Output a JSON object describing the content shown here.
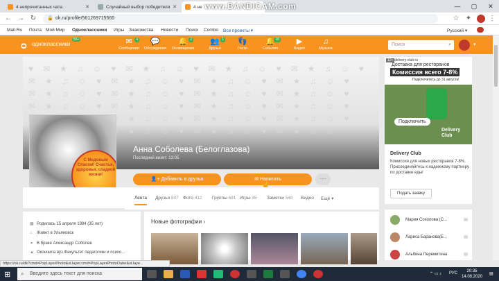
{
  "browser": {
    "tabs": [
      {
        "label": "4 непрочитанных чата"
      },
      {
        "label": "Случайный выбор победителя"
      },
      {
        "label": "4 не"
      }
    ],
    "watermark": "www.BANDICAM.com",
    "url": "ok.ru/profile/561269715565",
    "bookmarks": [
      "Mail.Ru",
      "Почта",
      "Мой Мир",
      "Одноклассники",
      "Игры",
      "Знакомства",
      "Новости",
      "Поиск",
      "Combo",
      "Все проекты ▾"
    ],
    "lang": "Русский ▾"
  },
  "ok": {
    "logo_text": "одноклассники",
    "badge": "55+",
    "nav": [
      {
        "label": "Сообщения",
        "count": "4",
        "icon": "envelope-icon",
        "glyph": "✉"
      },
      {
        "label": "Обсуждения",
        "count": "",
        "icon": "chat-icon",
        "glyph": "💬"
      },
      {
        "label": "Оповещения",
        "count": "2",
        "icon": "bell-icon",
        "glyph": "🔔"
      },
      {
        "label": "Друзья",
        "count": "1",
        "icon": "friends-icon",
        "glyph": "👥"
      },
      {
        "label": "Гости",
        "count": "",
        "icon": "guests-icon",
        "glyph": "👣"
      },
      {
        "label": "События",
        "count": "16",
        "icon": "events-icon",
        "glyph": "🔔"
      },
      {
        "label": "Видео",
        "count": "",
        "icon": "video-icon",
        "glyph": "▶"
      },
      {
        "label": "Музыка",
        "count": "",
        "icon": "music-icon",
        "glyph": "♫"
      }
    ],
    "search_placeholder": "Поиск"
  },
  "profile": {
    "name": "Анна Соболева (Белоглазова)",
    "last_visit": "Последний визит: 13:05",
    "sticker_text": "С Медовым Спасом! Счастья, здоровья, сладкой жизни!",
    "likes": "30",
    "add_friend": "Добавить в друзья",
    "write": "Написать",
    "more": "···",
    "tabs": [
      {
        "label": "Лента",
        "count": ""
      },
      {
        "label": "Друзья",
        "count": "847"
      },
      {
        "label": "Фото",
        "count": "412"
      },
      {
        "label": "Группы",
        "count": "691"
      },
      {
        "label": "Игры",
        "count": "35"
      },
      {
        "label": "Заметки",
        "count": "548"
      },
      {
        "label": "Видео",
        "count": ""
      },
      {
        "label": "Ещё ▾",
        "count": ""
      }
    ],
    "info": [
      "Родилась 15 апреля 1984 (35 лет)",
      "Живет в Ульяновск",
      "В браке Александр Соболев",
      "Окончила вуз Факультет педагогики и психо..."
    ],
    "photos_title": "Новые фотографии ›"
  },
  "ad": {
    "site": "delivery-club.ru",
    "tag": "12+",
    "line1": "Доставка для ресторанов",
    "line2": "Комиссия всего 7-8%",
    "line3": "Подключитесь до 31 августа!",
    "cta": "Подключить",
    "brand_img": "Delivery Club",
    "title": "Delivery Club",
    "text": "Комиссия для новых ресторанов 7-8%. Присоединяйтесь к надежному партнеру по доставке еды!",
    "button": "Подать заявку"
  },
  "friends": [
    {
      "name": "Мария Сохолова (С..."
    },
    {
      "name": "Лариса Баранова(Е..."
    },
    {
      "name": "Альбина Перемитина"
    }
  ],
  "status_url": "https://ok.ru/dk?cmd=PopLayerPhoto&st.layer.cmd=PopLayerPhotoOuter&st.laye...",
  "taskbar": {
    "search": "Введите здесь текст для поиска",
    "lang": "РУС",
    "time": "20:35",
    "date": "14.08.2020"
  },
  "colors": {
    "accent": "#f7931e",
    "green": "#3fb14a"
  }
}
